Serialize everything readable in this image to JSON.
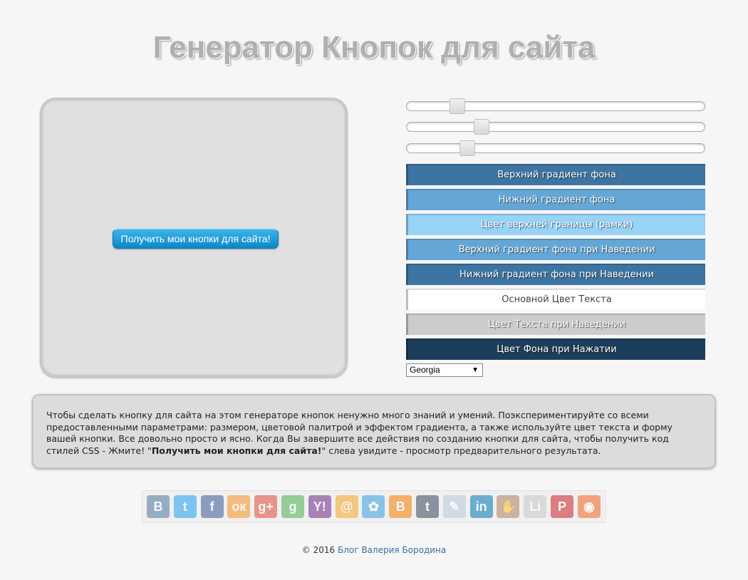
{
  "header": {
    "title": "Генератор Кнопок для сайта"
  },
  "preview": {
    "button_label": "Получить мои кнопки для сайта!"
  },
  "sliders": [
    {
      "name": "slider-1",
      "value": 0.17
    },
    {
      "name": "slider-2",
      "value": 0.25
    },
    {
      "name": "slider-3",
      "value": 0.2
    }
  ],
  "color_buttons": [
    {
      "label": "Верхний градиент фона",
      "bg": "#3d74a2",
      "text": "light"
    },
    {
      "label": "Нижний градиент фона",
      "bg": "#64a7d6",
      "text": "light"
    },
    {
      "label": "Цвет верхней границы (рамки)",
      "bg": "#97d2f7",
      "text": "light"
    },
    {
      "label": "Верхний градиент фона при Наведении",
      "bg": "#64a7d6",
      "text": "light"
    },
    {
      "label": "Нижний градиент фона при Наведении",
      "bg": "#3d74a2",
      "text": "light"
    },
    {
      "label": "Основной Цвет Текста",
      "bg": "#ffffff",
      "text": "dark"
    },
    {
      "label": "Цвет Текста при Наведении",
      "bg": "#cccccc",
      "text": "light"
    },
    {
      "label": "Цвет Фона при Нажатии",
      "bg": "#1c3e5a",
      "text": "light"
    }
  ],
  "font_select": {
    "value": "Georgia"
  },
  "info": {
    "text_before": "Чтобы сделать кнопку для сайта на этом генераторе кнопок ненужно много знаний и умений. Поэкспериментируйте со всеми предоставленными параметрами: размером, цветовой палитрой и эффектом градиента, а также используйте цвет текста и форму вашей кнопки. Все довольно просто и ясно. Когда Вы завершите все действия по созданию кнопки для сайта, чтобы получить код стилей CSS - Жмите! \"",
    "bold_text": "Получить мои кнопки для сайта!",
    "text_after": "\" слева увидите - просмотр предварительного результата."
  },
  "share_icons": [
    {
      "name": "vkontakte-icon",
      "glyph": "В",
      "color": "#4c75a3"
    },
    {
      "name": "twitter-icon",
      "glyph": "t",
      "color": "#1da1f2"
    },
    {
      "name": "facebook-icon",
      "glyph": "f",
      "color": "#3b5998"
    },
    {
      "name": "odnoklassniki-icon",
      "glyph": "ок",
      "color": "#f7931e"
    },
    {
      "name": "google-plus-icon",
      "glyph": "g+",
      "color": "#dd4b39"
    },
    {
      "name": "google-icon",
      "glyph": "g",
      "color": "#4caf50"
    },
    {
      "name": "yahoo-icon",
      "glyph": "Y!",
      "color": "#6a2a8a"
    },
    {
      "name": "mail-ru-icon",
      "glyph": "@",
      "color": "#f5a623"
    },
    {
      "name": "flower-icon",
      "glyph": "✿",
      "color": "#3aa0e0"
    },
    {
      "name": "blogger-icon",
      "glyph": "B",
      "color": "#f57d00"
    },
    {
      "name": "tumblr-icon",
      "glyph": "t",
      "color": "#35465c"
    },
    {
      "name": "livejournal-icon",
      "glyph": "✎",
      "color": "#b8c8d8"
    },
    {
      "name": "linkedin-icon",
      "glyph": "in",
      "color": "#0077b5"
    },
    {
      "name": "surfingbird-icon",
      "glyph": "✋",
      "color": "#b08060"
    },
    {
      "name": "liveinternet-icon",
      "glyph": "Li",
      "color": "#c8c8c8"
    },
    {
      "name": "pinterest-icon",
      "glyph": "P",
      "color": "#cb2027"
    },
    {
      "name": "rss-icon",
      "glyph": "◉",
      "color": "#f26522"
    }
  ],
  "footer": {
    "copyright": "© 2016",
    "link_text": "Блог Валерия Бородина"
  }
}
